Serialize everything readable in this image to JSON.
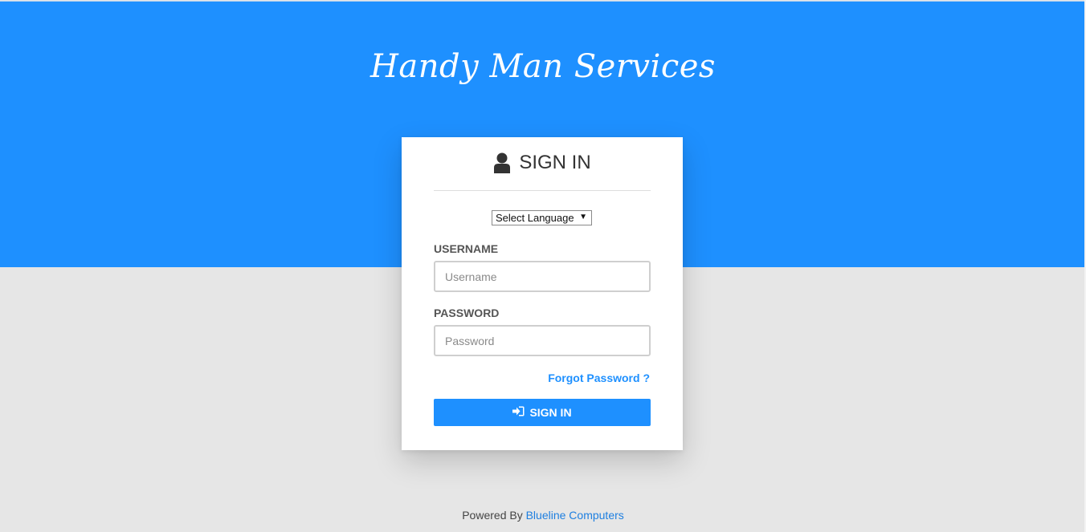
{
  "brand": {
    "title": "Handy Man Services"
  },
  "login": {
    "title": "SIGN IN",
    "language_select": {
      "selected": "Select Language"
    },
    "username": {
      "label": "USERNAME",
      "placeholder": "Username",
      "value": ""
    },
    "password": {
      "label": "PASSWORD",
      "placeholder": "Password",
      "value": ""
    },
    "forgot_password": "Forgot Password ?",
    "submit_label": "SIGN IN"
  },
  "footer": {
    "prefix": "Powered By",
    "link_text": "Blueline Computers"
  },
  "colors": {
    "primary": "#1e90ff",
    "background": "#e6e6e6",
    "card": "#ffffff"
  },
  "icons": {
    "title_icon": "user-icon",
    "button_icon": "sign-in-icon",
    "select_arrow": "dropdown-arrow-icon"
  }
}
